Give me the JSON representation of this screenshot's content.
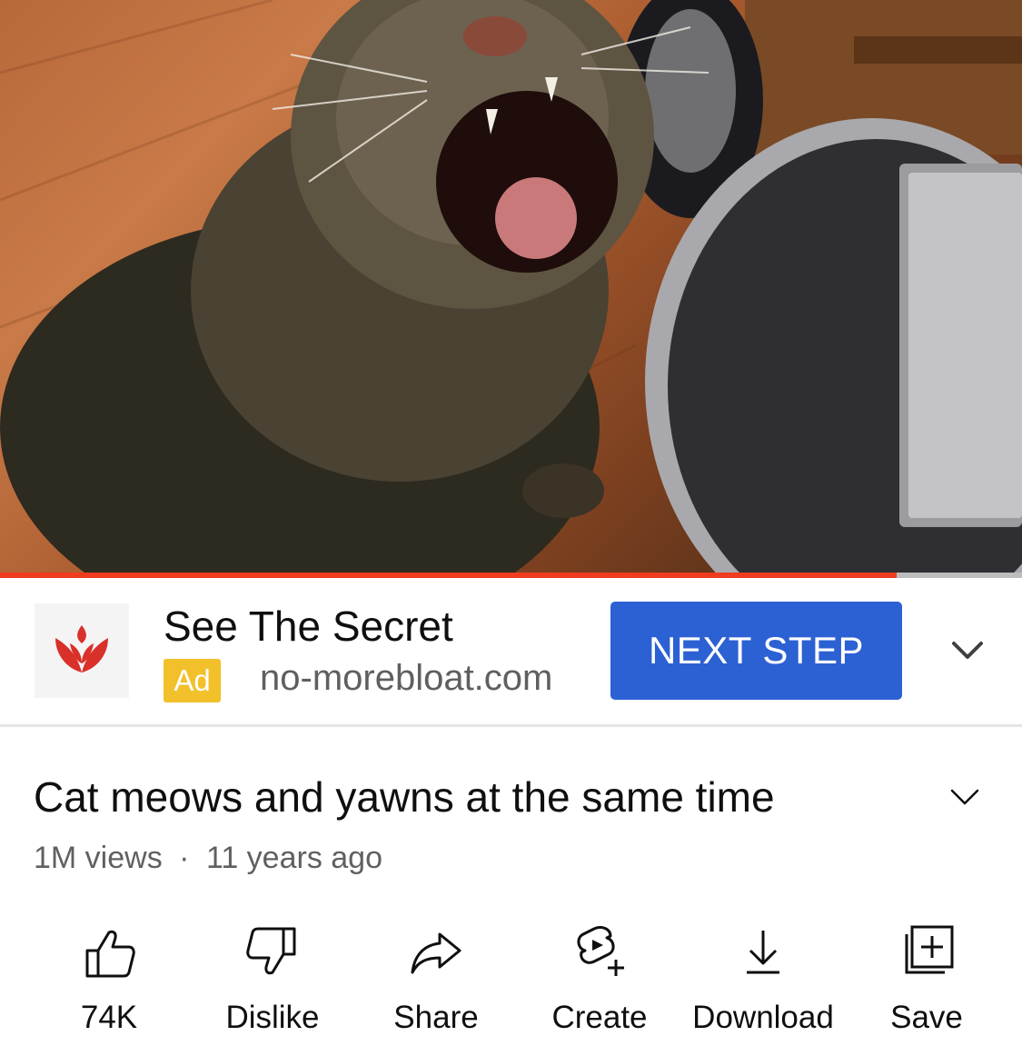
{
  "player": {
    "progress_fraction": 0.877,
    "colors": {
      "played": "#f03b1e",
      "track": "#bdbdbd"
    }
  },
  "ad": {
    "title": "See The Secret",
    "badge": "Ad",
    "domain": "no-morebloat.com",
    "cta_label": "NEXT STEP",
    "colors": {
      "cta": "#2c61d3",
      "badge": "#f2c02a",
      "logo": "#d9302a"
    }
  },
  "video": {
    "title": "Cat meows and yawns at the same time",
    "views": "1M views",
    "separator": "·",
    "age": "11 years ago"
  },
  "actions": [
    {
      "icon": "thumbs-up-icon",
      "label": "74K"
    },
    {
      "icon": "thumbs-down-icon",
      "label": "Dislike"
    },
    {
      "icon": "share-icon",
      "label": "Share"
    },
    {
      "icon": "create-icon",
      "label": "Create"
    },
    {
      "icon": "download-icon",
      "label": "Download"
    },
    {
      "icon": "save-playlist-icon",
      "label": "Save"
    }
  ]
}
